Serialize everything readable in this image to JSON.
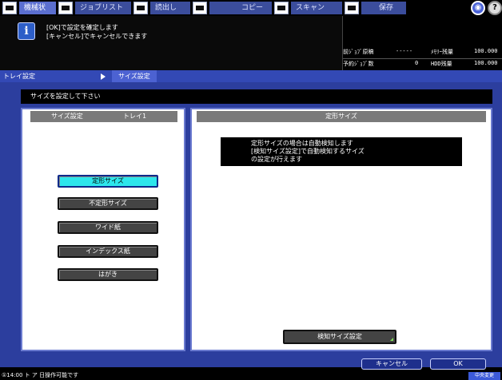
{
  "tabs": [
    {
      "label": "機械状態",
      "icon": "machine-icon"
    },
    {
      "label": "ジョブリスト",
      "icon": "list-icon"
    },
    {
      "label": "読出し",
      "icon": "recall-icon"
    },
    {
      "label": "コピー",
      "icon": "copy-icon"
    },
    {
      "label": "スキャン",
      "icon": "scan-icon"
    },
    {
      "label": "保存",
      "icon": "save-icon"
    }
  ],
  "message": {
    "line1": "[OK]で設定を確定します",
    "line2": "[キャンセル]でキャンセルできます"
  },
  "status": {
    "row1_label": "前ｼﾞｮﾌﾞ原稿",
    "row1_value": "-----",
    "row1_label2": "ﾒﾓﾘｰ残量",
    "row1_value2": "100.000",
    "row2_label": "予約ｼﾞｮﾌﾞ数",
    "row2_value": "0",
    "row2_label2": "HDD残量",
    "row2_value2": "100.000"
  },
  "breadcrumb": {
    "parent": "トレイ設定",
    "current": "サイズ設定"
  },
  "instruction": "サイズを設定して下さい",
  "left_panel": {
    "header_left": "サイズ設定",
    "header_right": "トレイ1",
    "options": [
      {
        "label": "定形サイズ",
        "selected": true
      },
      {
        "label": "不定形サイズ",
        "selected": false
      },
      {
        "label": "ワイド紙",
        "selected": false
      },
      {
        "label": "インデックス紙",
        "selected": false
      },
      {
        "label": "はがき",
        "selected": false
      }
    ]
  },
  "right_panel": {
    "header": "定形サイズ",
    "note_line1": "定形サイズの場合は自動検知します",
    "note_line2": "[検知サイズ設定]で自動検知するサイズ",
    "note_line3": "の設定が行えます",
    "detect_button": "検知サイズ設定"
  },
  "actions": {
    "cancel": "キャンセル",
    "ok": "OK"
  },
  "footer": {
    "text": "①14:00 ト ア 日操作可能です",
    "badge": "中央変更"
  },
  "colors": {
    "accent": "#3349b5",
    "selected": "#2de6ec",
    "panel_bg": "#2c3e9e"
  }
}
